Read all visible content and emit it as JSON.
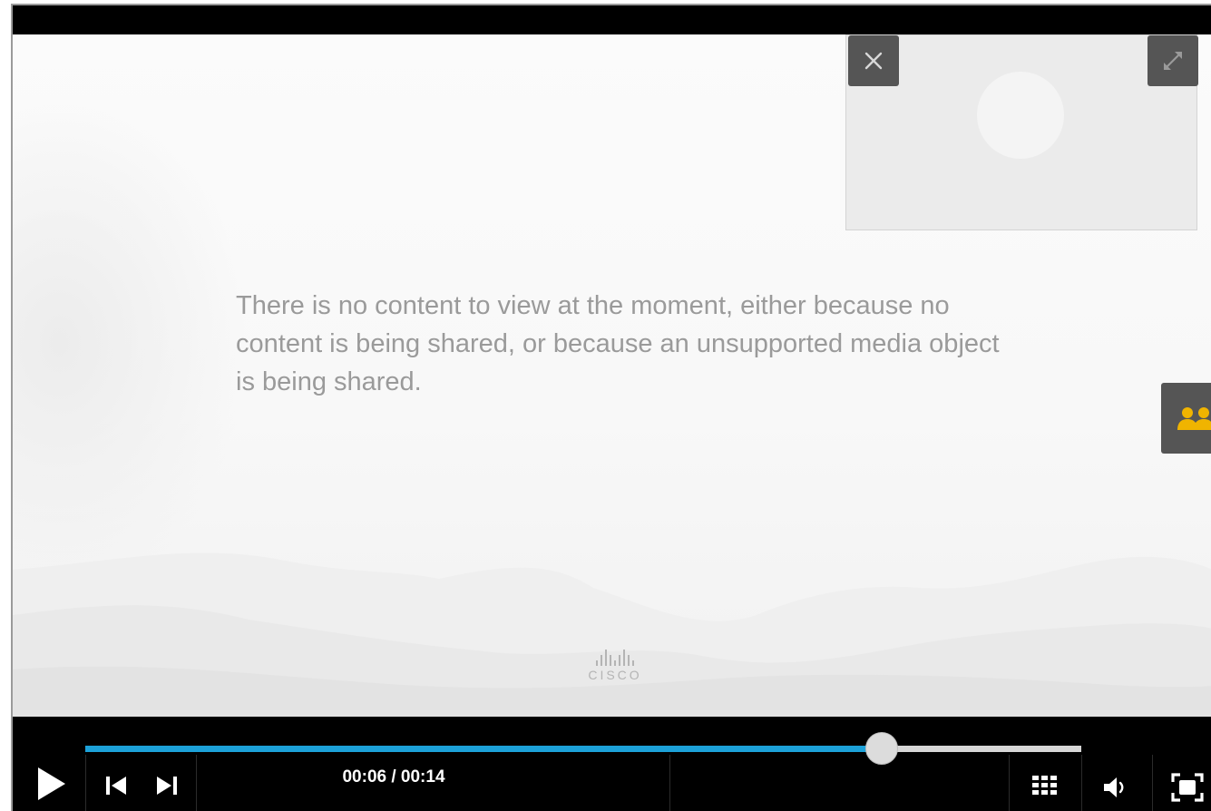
{
  "stage": {
    "message": "There is no content to view at the moment, either because no content is being shared, or because an unsupported media object is being shared.",
    "logo_text": "CISCO"
  },
  "pip": {
    "close_icon": "close-icon",
    "expand_icon": "expand-icon"
  },
  "participants_button": {
    "icon": "participants-icon",
    "color": "#f0b400"
  },
  "player": {
    "time": "00:06 / 00:14",
    "progress_fraction": 0.8,
    "accent_color": "#1ca1d8",
    "icons": [
      "play-icon",
      "previous-icon",
      "next-icon",
      "grid-icon",
      "volume-icon",
      "fullscreen-icon"
    ]
  }
}
